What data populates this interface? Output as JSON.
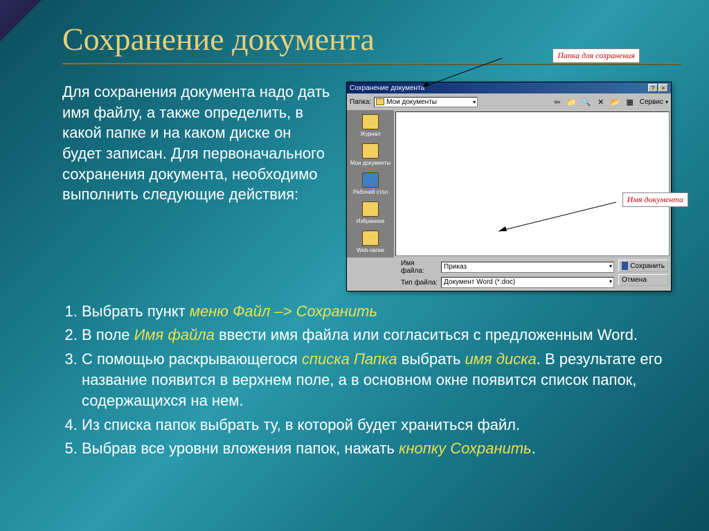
{
  "title": "Сохранение документа",
  "intro": "Для сохранения документа надо дать имя файлу, а также определить, в какой папке и на каком диске он будет записан. Для первоначального сохранения документа, необходимо выполнить следующие действия:",
  "callouts": {
    "folder": "Папка для сохранения",
    "docname": "Имя документа"
  },
  "dialog": {
    "title": "Сохранение документа",
    "folder_label": "Папка:",
    "folder_value": "Мои документы",
    "service": "Сервис",
    "places": [
      "Журнал",
      "Мои документы",
      "Рабочий стол",
      "Избранное",
      "Web-папки"
    ],
    "filename_label": "Имя файла:",
    "filename_value": "Приказ",
    "filetype_label": "Тип файла:",
    "filetype_value": "Документ Word (*.doc)",
    "save_btn": "Сохранить",
    "cancel_btn": "Отмена"
  },
  "list": {
    "i1_a": "Выбрать пункт ",
    "i1_b": "меню Файл –> Сохранить",
    "i2_a": "В поле ",
    "i2_b": "Имя файла",
    "i2_c": " ввести имя файла или согласиться с предложенным Word.",
    "i3_a": "С помощью раскрывающегося ",
    "i3_b": "списка Папка",
    "i3_c": " выбрать ",
    "i3_d": "имя диска",
    "i3_e": ". В результате его название появится в верхнем поле, а в основном окне появится список папок, содержащихся на нем.",
    "i4": "Из списка папок выбрать ту, в которой будет храниться файл.",
    "i5_a": "Выбрав все уровни вложения папок, нажать ",
    "i5_b": "кнопку Сохранить",
    "i5_c": "."
  }
}
